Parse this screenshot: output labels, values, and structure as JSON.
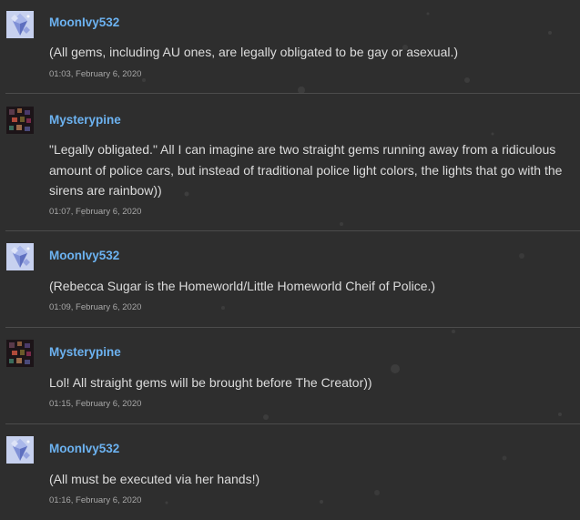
{
  "comments": [
    {
      "username": "MoonIvy532",
      "avatar": "crystal-avatar",
      "text": "(All gems, including AU ones, are legally obligated to be gay or asexual.)",
      "time": "01:03, February 6, 2020"
    },
    {
      "username": "Mysterypine",
      "avatar": "pixel-avatar",
      "text": "\"Legally obligated.\" All I can imagine are two straight gems running away from a ridiculous amount of police cars, but instead of traditional police light colors, the lights that go with the sirens are rainbow))",
      "time": "01:07, February 6, 2020"
    },
    {
      "username": "MoonIvy532",
      "avatar": "crystal-avatar",
      "text": "(Rebecca Sugar is the Homeworld/Little Homeworld Cheif of Police.)",
      "time": "01:09, February 6, 2020"
    },
    {
      "username": "Mysterypine",
      "avatar": "pixel-avatar",
      "text": "Lol! All straight gems will be brought before The Creator))",
      "time": "01:15, February 6, 2020"
    },
    {
      "username": "MoonIvy532",
      "avatar": "crystal-avatar",
      "text": "(All must be executed via her hands!)",
      "time": "01:16, February 6, 2020"
    }
  ],
  "colors": {
    "background": "#2e2e2e",
    "username": "#6cb2f0",
    "text": "#dcdcdc",
    "timestamp": "#a8a8a8",
    "divider": "#4c4c4c"
  }
}
